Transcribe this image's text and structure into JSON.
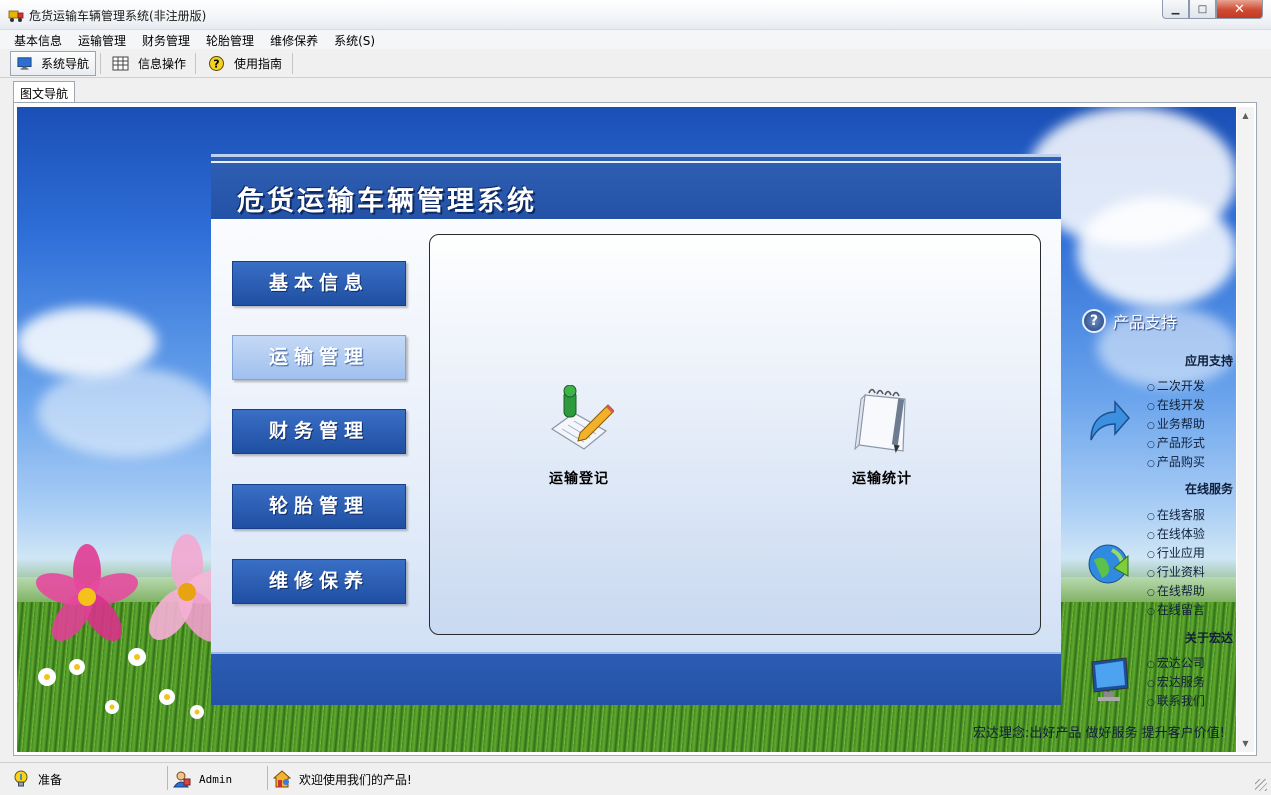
{
  "window": {
    "title": "危货运输车辆管理系统(非注册版)",
    "controls": {
      "minimize": "▁",
      "maximize": "□",
      "close": "✕"
    }
  },
  "menu": [
    {
      "label": "基本信息"
    },
    {
      "label": "运输管理"
    },
    {
      "label": "财务管理"
    },
    {
      "label": "轮胎管理"
    },
    {
      "label": "维修保养"
    },
    {
      "label": "系统(S)"
    }
  ],
  "toolbar": {
    "nav": "系统导航",
    "info": "信息操作",
    "guide": "使用指南"
  },
  "tab": {
    "label": "图文导航"
  },
  "panel": {
    "title": "危货运输车辆管理系统",
    "nav_buttons": [
      "基本信息",
      "运输管理",
      "财务管理",
      "轮胎管理",
      "维修保养"
    ],
    "selected_nav": "运输管理",
    "functions": {
      "register": "运输登记",
      "stats": "运输统计"
    }
  },
  "side": {
    "title": "产品支持",
    "sections": [
      {
        "heading": "应用支持",
        "links": [
          "二次开发",
          "在线开发",
          "业务帮助",
          "产品形式",
          "产品购买"
        ]
      },
      {
        "heading": "在线服务",
        "links": [
          "在线客服",
          "在线体验",
          "行业应用",
          "行业资料",
          "在线帮助",
          "在线留言"
        ]
      },
      {
        "heading": "关于宏达",
        "links": [
          "宏达公司",
          "宏达服务",
          "联系我们"
        ]
      }
    ],
    "slogan": "宏达理念:出好产品 做好服务 提升客户价值!"
  },
  "status": {
    "ready": "准备",
    "user": "Admin",
    "message": "欢迎使用我们的产品!"
  },
  "colors": {
    "header_blue": "#2352a6",
    "nav_button": "#2a5bb4",
    "nav_selected": "#b3cdf2"
  },
  "icons": {
    "app": "truck-icon",
    "nav": "monitor-icon",
    "info": "grid-icon",
    "guide": "help-icon",
    "register": "pencil-notepad-icon",
    "stats": "spiral-notebook-icon"
  }
}
